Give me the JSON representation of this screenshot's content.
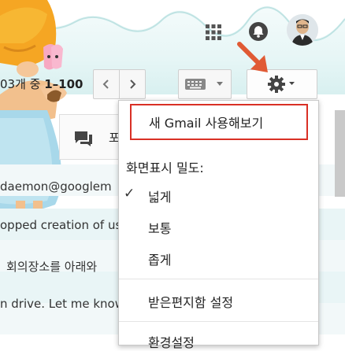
{
  "header": {
    "page_range": {
      "prefix": "03개 중 ",
      "range": "1–100"
    },
    "apps_icon": "grid-apps-icon",
    "notifications_icon": "bell-icon",
    "account_icon": "avatar"
  },
  "tabs": {
    "primary_label": "포"
  },
  "email_rows": [
    {
      "text": "daemon@googlem"
    },
    {
      "text": "opped creation of us"
    },
    {
      "text": "회의장소를 아래와"
    },
    {
      "text": "n drive. Let me know"
    },
    {
      "text": ""
    }
  ],
  "settings_menu": {
    "try_new_gmail": "새 Gmail 사용해보기",
    "density_heading": "화면표시 밀도:",
    "density_options": [
      {
        "label": "넓게",
        "selected": true
      },
      {
        "label": "보통",
        "selected": false
      },
      {
        "label": "좁게",
        "selected": false
      }
    ],
    "inbox_settings": "받은편지함 설정",
    "settings_partial": "환경설정"
  },
  "colors": {
    "highlight_border": "#d93025",
    "arrow": "#e05a34",
    "theme_band": "#d8f0f0"
  }
}
